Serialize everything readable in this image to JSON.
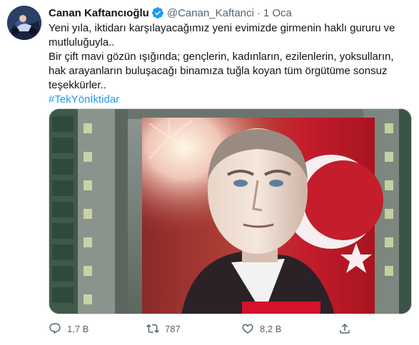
{
  "tweet": {
    "display_name": "Canan Kaftancıoğlu",
    "handle": "@Canan_Kaftanci",
    "separator": "·",
    "date": "1 Oca",
    "text_lines": [
      "Yeni yıla, iktidarı karşılayacağımız yeni evimizde girmenin haklı gururu ve mutluluğuyla..",
      "Bir çift mavi gözün ışığında; gençlerin, kadınların, ezilenlerin, yoksulların, hak arayanların buluşacağı binamıza tuğla koyan tüm örgütüme sonsuz teşekkürler.."
    ],
    "hashtag": "#TekYönİktidar",
    "verified_icon": "verified-badge-icon",
    "verified_color": "#1d9bf0"
  },
  "actions": {
    "reply_count": "1,7 B",
    "retweet_count": "787",
    "like_count": "8,2 B",
    "reply_icon": "reply-icon",
    "retweet_icon": "retweet-icon",
    "like_icon": "heart-icon",
    "share_icon": "share-icon"
  },
  "colors": {
    "text": "#0f1419",
    "secondary": "#536471",
    "link": "#1d9bf0",
    "flag_red": "#d3132a"
  }
}
